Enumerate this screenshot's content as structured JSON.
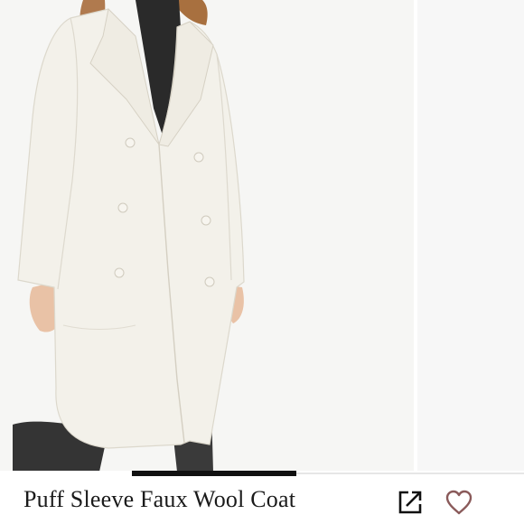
{
  "listing": {
    "title": "Puff Sleeve Faux Wool Coat"
  },
  "gallery": {
    "current_index": 1,
    "image_count": 3,
    "image_subject": "woman-wearing-cream-double-breasted-coat"
  },
  "actions": {
    "share_icon": "external-share-icon",
    "like_icon": "heart-outline-icon"
  },
  "colors": {
    "coat": "#f3f1ea",
    "background": "#f6f6f4",
    "active_indicator": "#111111",
    "heart_outline": "#8a5a5a",
    "text": "#1a1a1a"
  }
}
